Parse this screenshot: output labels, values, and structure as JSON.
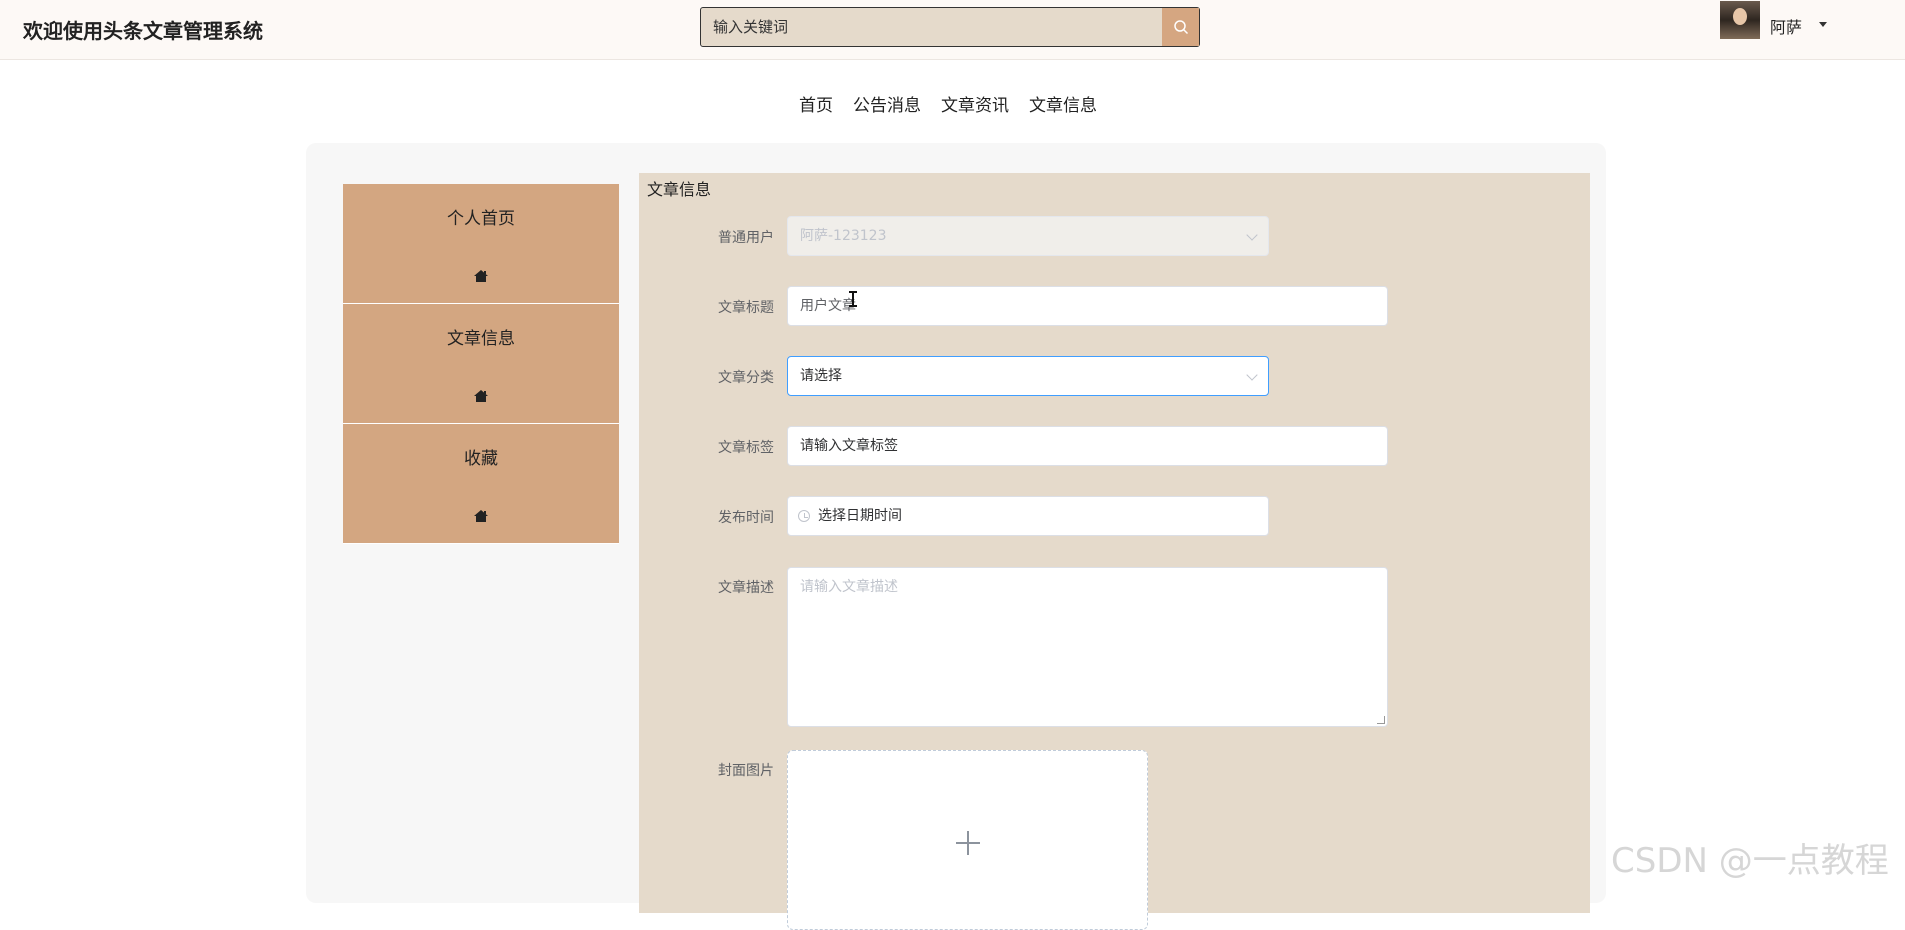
{
  "header": {
    "site_title": "欢迎使用头条文章管理系统",
    "search_placeholder": "输入关键词",
    "user_name": "阿萨"
  },
  "nav": {
    "items": [
      "首页",
      "公告消息",
      "文章资讯",
      "文章信息"
    ]
  },
  "sidebar": {
    "items": [
      {
        "label": "个人首页",
        "icon": "home-icon"
      },
      {
        "label": "文章信息",
        "icon": "home-icon"
      },
      {
        "label": "收藏",
        "icon": "home-icon"
      }
    ]
  },
  "form": {
    "title": "文章信息",
    "user_label": "普通用户",
    "user_value": "阿萨-123123",
    "article_title_label": "文章标题",
    "article_title_value": "用户文章",
    "category_label": "文章分类",
    "category_value": "请选择",
    "tag_label": "文章标签",
    "tag_value": "请输入文章标签",
    "publish_time_label": "发布时间",
    "publish_time_value": "选择日期时间",
    "description_label": "文章描述",
    "description_placeholder": "请输入文章描述",
    "cover_label": "封面图片"
  },
  "watermark": "CSDN @一点教程",
  "colors": {
    "accent": "#d3a681",
    "form_bg": "#e5dacb",
    "focus_border": "#409eff"
  }
}
